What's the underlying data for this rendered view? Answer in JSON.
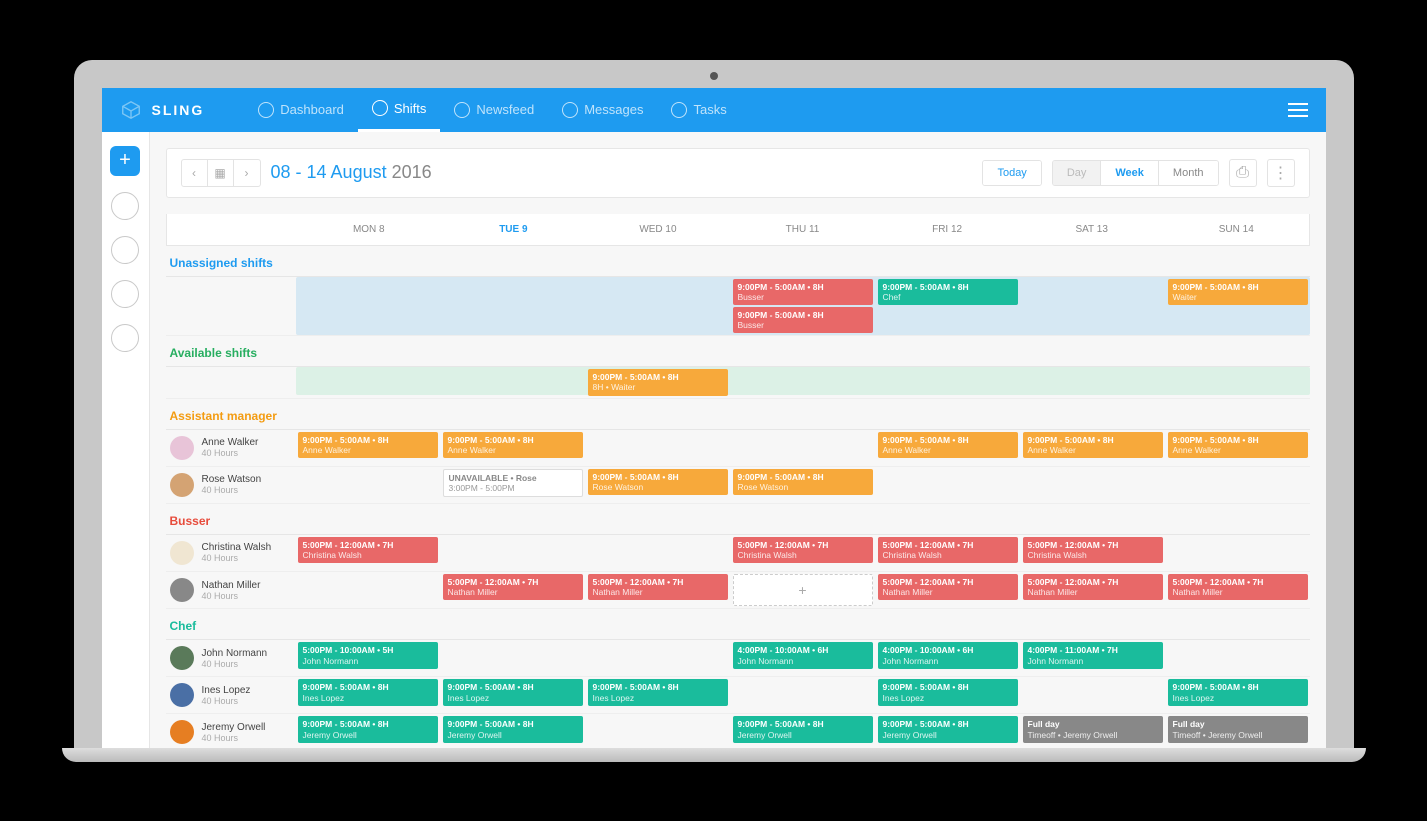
{
  "brand": "SLING",
  "nav": [
    "Dashboard",
    "Shifts",
    "Newsfeed",
    "Messages",
    "Tasks"
  ],
  "nav_active": 1,
  "toolbar": {
    "date_main": "08 - 14 August",
    "date_year": "2016",
    "today": "Today",
    "views": [
      "Day",
      "Week",
      "Month"
    ],
    "view_active": 1
  },
  "days": [
    "MON 8",
    "TUE 9",
    "WED 10",
    "THU 11",
    "FRI 12",
    "SAT 13",
    "SUN 14"
  ],
  "day_active": 1,
  "sections": {
    "unassigned": {
      "label": "Unassigned shifts",
      "color": "#1e9bf0"
    },
    "available": {
      "label": "Available shifts",
      "color": "#27ae60"
    },
    "asst_mgr": {
      "label": "Assistant manager",
      "color": "#f39c12"
    },
    "busser": {
      "label": "Busser",
      "color": "#e74c3c"
    },
    "chef": {
      "label": "Chef",
      "color": "#1abc9c"
    }
  },
  "unassigned_shifts": {
    "3": [
      {
        "t": "9:00PM - 5:00AM • 8H",
        "s": "Busser",
        "c": "red"
      },
      {
        "t": "9:00PM - 5:00AM • 8H",
        "s": "Busser",
        "c": "red"
      }
    ],
    "4": [
      {
        "t": "9:00PM - 5:00AM • 8H",
        "s": "Chef",
        "c": "green"
      }
    ],
    "6": [
      {
        "t": "9:00PM - 5:00AM • 8H",
        "s": "Waiter",
        "c": "orange"
      }
    ]
  },
  "available_shifts": {
    "2": [
      {
        "t": "9:00PM - 5:00AM • 8H",
        "s": "8H • Waiter",
        "c": "orange"
      }
    ]
  },
  "employees": [
    {
      "section": "asst_mgr",
      "name": "Anne Walker",
      "hours": "40 Hours",
      "av": "#e8c4d8",
      "shifts": {
        "0": {
          "t": "9:00PM - 5:00AM • 8H",
          "s": "Anne Walker",
          "c": "orange"
        },
        "1": {
          "t": "9:00PM - 5:00AM • 8H",
          "s": "Anne Walker",
          "c": "orange"
        },
        "4": {
          "t": "9:00PM - 5:00AM • 8H",
          "s": "Anne Walker",
          "c": "orange"
        },
        "5": {
          "t": "9:00PM - 5:00AM • 8H",
          "s": "Anne Walker",
          "c": "orange"
        },
        "6": {
          "t": "9:00PM - 5:00AM • 8H",
          "s": "Anne Walker",
          "c": "orange"
        }
      }
    },
    {
      "section": "asst_mgr",
      "name": "Rose Watson",
      "hours": "40 Hours",
      "av": "#d4a373",
      "shifts": {
        "1": {
          "t": "UNAVAILABLE • Rose",
          "s": "3:00PM - 5:00PM",
          "c": "unavail"
        },
        "2": {
          "t": "9:00PM - 5:00AM • 8H",
          "s": "Rose Watson",
          "c": "orange"
        },
        "3": {
          "t": "9:00PM - 5:00AM • 8H",
          "s": "Rose Watson",
          "c": "orange"
        }
      }
    },
    {
      "section": "busser",
      "name": "Christina Walsh",
      "hours": "40 Hours",
      "av": "#f0e6d2",
      "shifts": {
        "0": {
          "t": "5:00PM - 12:00AM • 7H",
          "s": "Christina Walsh",
          "c": "red"
        },
        "3": {
          "t": "5:00PM - 12:00AM • 7H",
          "s": "Christina Walsh",
          "c": "red"
        },
        "4": {
          "t": "5:00PM - 12:00AM • 7H",
          "s": "Christina Walsh",
          "c": "red"
        },
        "5": {
          "t": "5:00PM - 12:00AM • 7H",
          "s": "Christina Walsh",
          "c": "red"
        }
      }
    },
    {
      "section": "busser",
      "name": "Nathan Miller",
      "hours": "40 Hours",
      "av": "#888",
      "shifts": {
        "1": {
          "t": "5:00PM - 12:00AM • 7H",
          "s": "Nathan Miller",
          "c": "red"
        },
        "2": {
          "t": "5:00PM - 12:00AM • 7H",
          "s": "Nathan Miller",
          "c": "red"
        },
        "3": {
          "t": "+",
          "s": "",
          "c": "add-slot"
        },
        "4": {
          "t": "5:00PM - 12:00AM • 7H",
          "s": "Nathan Miller",
          "c": "red"
        },
        "5": {
          "t": "5:00PM - 12:00AM • 7H",
          "s": "Nathan Miller",
          "c": "red"
        },
        "6": {
          "t": "5:00PM - 12:00AM • 7H",
          "s": "Nathan Miller",
          "c": "red"
        }
      }
    },
    {
      "section": "chef",
      "name": "John Normann",
      "hours": "40 Hours",
      "av": "#5a7a5a",
      "shifts": {
        "0": {
          "t": "5:00PM - 10:00AM • 5H",
          "s": "John Normann",
          "c": "green"
        },
        "3": {
          "t": "4:00PM - 10:00AM • 6H",
          "s": "John Normann",
          "c": "green"
        },
        "4": {
          "t": "4:00PM - 10:00AM • 6H",
          "s": "John Normann",
          "c": "green"
        },
        "5": {
          "t": "4:00PM - 11:00AM • 7H",
          "s": "John Normann",
          "c": "green"
        }
      }
    },
    {
      "section": "chef",
      "name": "Ines Lopez",
      "hours": "40 Hours",
      "av": "#4a6fa5",
      "shifts": {
        "0": {
          "t": "9:00PM - 5:00AM • 8H",
          "s": "Ines Lopez",
          "c": "green"
        },
        "1": {
          "t": "9:00PM - 5:00AM • 8H",
          "s": "Ines Lopez",
          "c": "green"
        },
        "2": {
          "t": "9:00PM - 5:00AM • 8H",
          "s": "Ines Lopez",
          "c": "green"
        },
        "4": {
          "t": "9:00PM - 5:00AM • 8H",
          "s": "Ines Lopez",
          "c": "green"
        },
        "6": {
          "t": "9:00PM - 5:00AM • 8H",
          "s": "Ines Lopez",
          "c": "green"
        }
      }
    },
    {
      "section": "chef",
      "name": "Jeremy Orwell",
      "hours": "40 Hours",
      "av": "#e67e22",
      "shifts": {
        "0": {
          "t": "9:00PM - 5:00AM • 8H",
          "s": "Jeremy Orwell",
          "c": "green"
        },
        "1": {
          "t": "9:00PM - 5:00AM • 8H",
          "s": "Jeremy Orwell",
          "c": "green"
        },
        "3": {
          "t": "9:00PM - 5:00AM • 8H",
          "s": "Jeremy Orwell",
          "c": "green"
        },
        "4": {
          "t": "9:00PM - 5:00AM • 8H",
          "s": "Jeremy Orwell",
          "c": "green"
        },
        "5": {
          "t": "Full day",
          "s": "Timeoff • Jeremy Orwell",
          "c": "grey"
        },
        "6": {
          "t": "Full day",
          "s": "Timeoff • Jeremy Orwell",
          "c": "grey"
        }
      }
    }
  ]
}
